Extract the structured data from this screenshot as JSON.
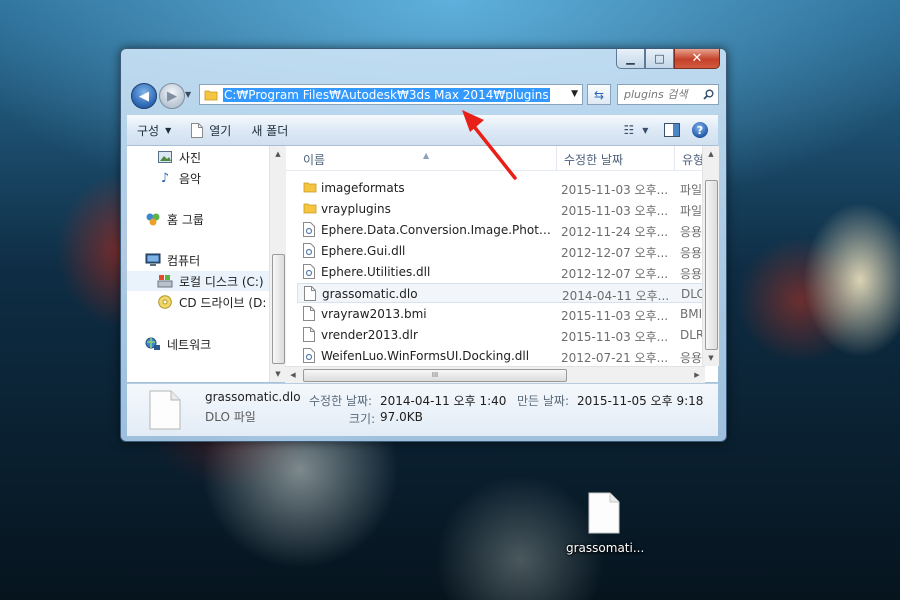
{
  "window": {
    "caption_buttons": {
      "minimize": "▁",
      "maximize": "□",
      "close": "✕"
    },
    "address": {
      "path": "C:₩Program Files₩Autodesk₩3ds Max 2014₩plugins"
    },
    "search": {
      "placeholder": "plugins 검색"
    },
    "toolbar": {
      "organize": "구성",
      "open": "열기",
      "new_folder": "새 폴더"
    },
    "nav_pane": {
      "items": [
        {
          "label": "사진",
          "icon": "pictures-icon"
        },
        {
          "label": "음악",
          "icon": "music-icon"
        },
        {
          "label": "홈 그룹",
          "icon": "homegroup-icon"
        },
        {
          "label": "컴퓨터",
          "icon": "computer-icon"
        },
        {
          "label": "로컬 디스크 (C:)",
          "icon": "local-disk-icon"
        },
        {
          "label": "CD 드라이브 (D:",
          "icon": "cd-drive-icon"
        },
        {
          "label": "네트워크",
          "icon": "network-icon"
        }
      ]
    },
    "columns": {
      "name": "이름",
      "modified": "수정한 날짜",
      "type": "유형"
    },
    "files": [
      {
        "name": "imageformats",
        "date": "2015-11-03 오후...",
        "type": "파일",
        "icon": "folder-icon"
      },
      {
        "name": "vrayplugins",
        "date": "2015-11-03 오후...",
        "type": "파일",
        "icon": "folder-icon"
      },
      {
        "name": "Ephere.Data.Conversion.Image.Photosho...",
        "date": "2012-11-24 오후...",
        "type": "응용",
        "icon": "dll-file-icon"
      },
      {
        "name": "Ephere.Gui.dll",
        "date": "2012-12-07 오후...",
        "type": "응용",
        "icon": "dll-file-icon"
      },
      {
        "name": "Ephere.Utilities.dll",
        "date": "2012-12-07 오후...",
        "type": "응용",
        "icon": "dll-file-icon"
      },
      {
        "name": "grassomatic.dlo",
        "date": "2014-04-11 오후...",
        "type": "DLO",
        "icon": "blank-file-icon"
      },
      {
        "name": "vrayraw2013.bmi",
        "date": "2015-11-03 오후...",
        "type": "BMI",
        "icon": "blank-file-icon"
      },
      {
        "name": "vrender2013.dlr",
        "date": "2015-11-03 오후...",
        "type": "DLR",
        "icon": "blank-file-icon"
      },
      {
        "name": "WeifenLuo.WinFormsUI.Docking.dll",
        "date": "2012-07-21 오후...",
        "type": "응용",
        "icon": "dll-file-icon"
      }
    ],
    "hscroll_grip": "III",
    "details": {
      "name": "grassomatic.dlo",
      "type": "DLO 파일",
      "modified_label": "수정한 날짜:",
      "modified_value": "2014-04-11 오후 1:40",
      "created_label": "만든 날짜:",
      "created_value": "2015-11-05 오후 9:18",
      "size_label": "크기:",
      "size_value": "97.0KB"
    }
  },
  "desktop": {
    "icon_label": "grassomati..."
  },
  "colors": {
    "selection": "#3399ff",
    "annotation_arrow": "#e8201a"
  }
}
